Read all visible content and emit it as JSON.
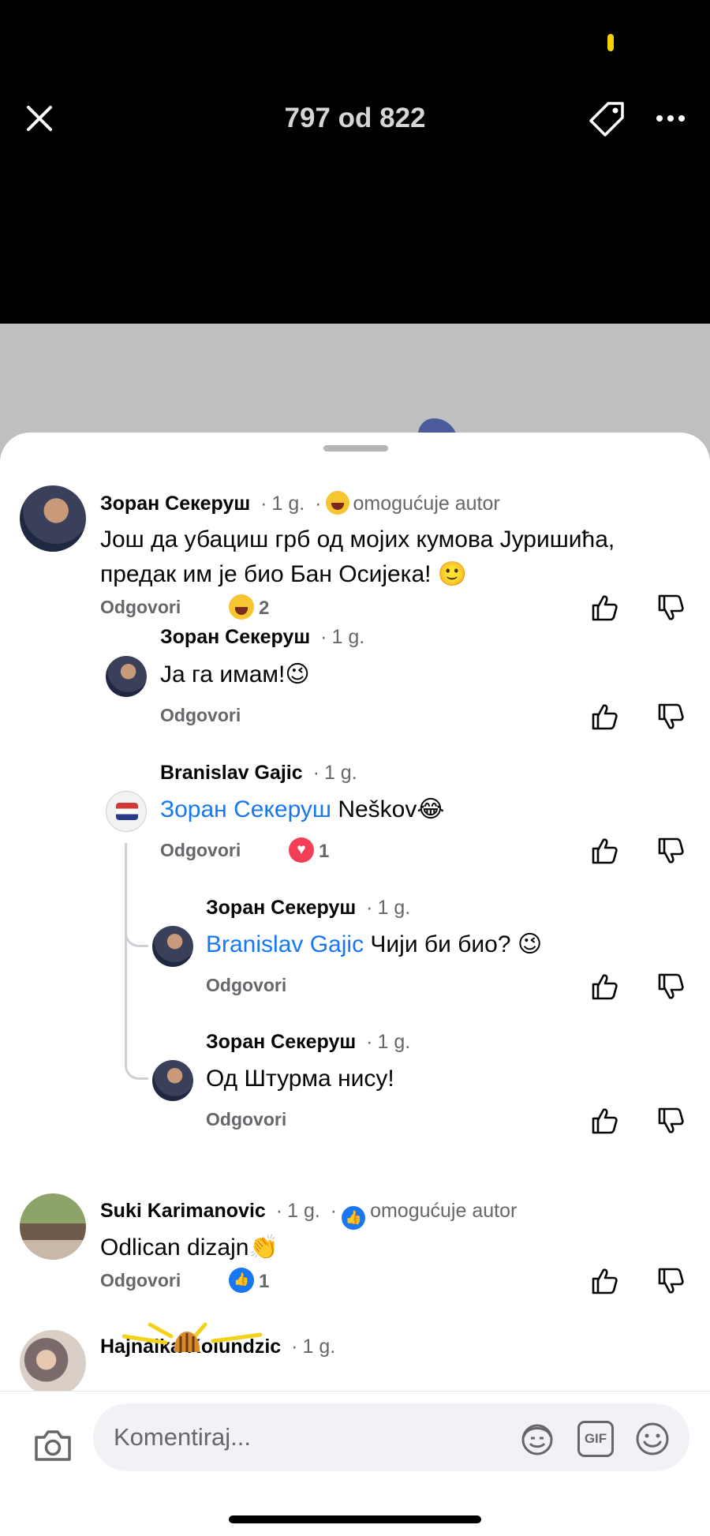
{
  "viewer": {
    "counter": "797 od 822"
  },
  "comments": [
    {
      "author": "Зоран Секеруш",
      "age": "1 g.",
      "badge": "omogućuje autor",
      "text_line1": "Још да убациш грб од мојих кумова Јуришића,",
      "text_line2": "предак им је био Бан Осијека! 🙂",
      "reply_label": "Odgovori",
      "reaction_count": "2"
    },
    {
      "author": "Зоран Секеруш",
      "age": "1 g.",
      "text": "Ја га имам!😉",
      "reply_label": "Odgovori"
    },
    {
      "author": "Branislav Gajic",
      "age": "1 g.",
      "mention": "Зоран Секеруш",
      "text": " Neškov😂",
      "reply_label": "Odgovori",
      "reaction_count": "1"
    },
    {
      "author": "Зоран Секеруш",
      "age": "1 g.",
      "mention": "Branislav Gajic",
      "text": "  Чији би био? 😉",
      "reply_label": "Odgovori"
    },
    {
      "author": "Зоран Секеруш",
      "age": "1 g.",
      "text": "Од Штурма нису!",
      "reply_label": "Odgovori"
    },
    {
      "author": "Suki Karimanovic",
      "age": "1 g.",
      "badge": "omogućuje autor",
      "text": "Odlican dizajn👏",
      "reply_label": "Odgovori",
      "reaction_count": "1"
    },
    {
      "author": "Hajnalka Kolundzic",
      "age": "1 g."
    }
  ],
  "composer": {
    "placeholder": "Komentiraj...",
    "gif_label": "GIF"
  },
  "icons": {
    "close": "close-icon",
    "tag": "tag-icon",
    "more": "more-icon",
    "like": "thumbs-up-icon",
    "dislike": "thumbs-down-icon",
    "camera": "camera-icon",
    "avatar": "avatar-sticker-icon",
    "smile": "emoji-icon"
  },
  "colors": {
    "accent": "#1877f2",
    "heart": "#f33e58",
    "secondary_text": "#65676b"
  }
}
